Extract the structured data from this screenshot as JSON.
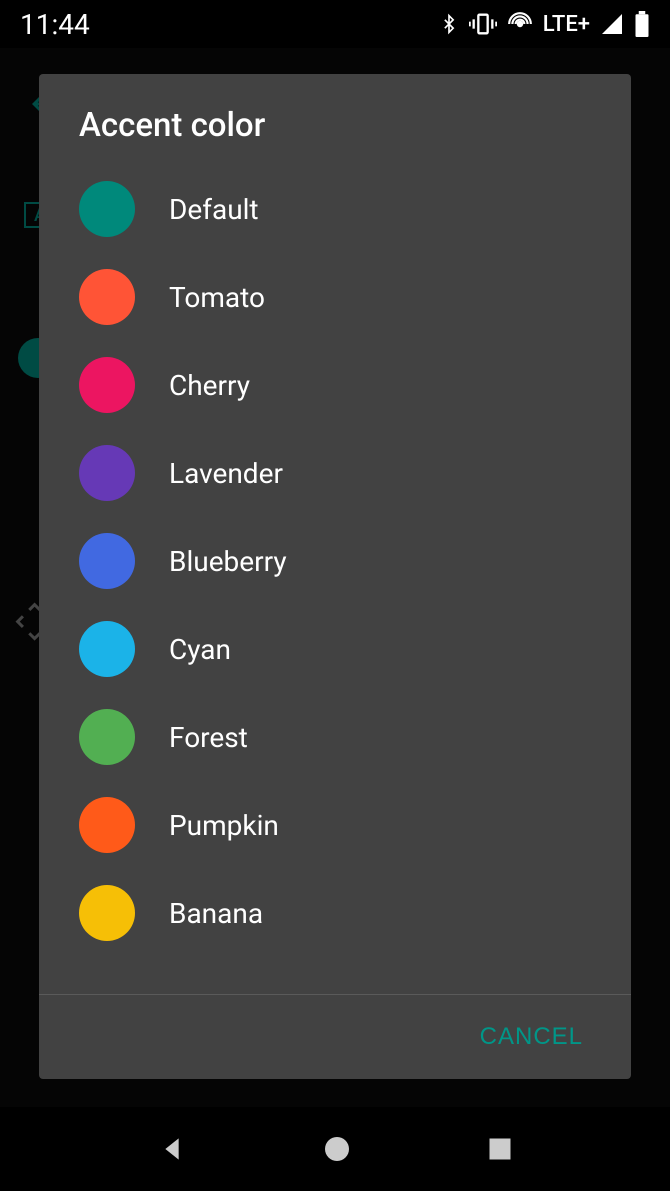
{
  "status": {
    "time": "11:44",
    "network": "LTE+"
  },
  "dialog": {
    "title": "Accent color",
    "cancel": "CANCEL",
    "colors": [
      {
        "name": "Default",
        "hex": "#008577"
      },
      {
        "name": "Tomato",
        "hex": "#F4511E"
      },
      {
        "name": "Cherry",
        "hex": "#E91E63"
      },
      {
        "name": "Lavender",
        "hex": "#673AB7"
      },
      {
        "name": "Blueberry",
        "hex": "#3B78E7"
      },
      {
        "name": "Cyan",
        "hex": "#00B8D4"
      },
      {
        "name": "Forest",
        "hex": "#4CAF50"
      },
      {
        "name": "Pumpkin",
        "hex": "#F4511E"
      },
      {
        "name": "Banana",
        "hex": "#F9C000"
      }
    ]
  },
  "colors_actual": {
    "0": "#00897B",
    "1": "#FF5436",
    "2": "#EC1561",
    "3": "#6639B6",
    "4": "#4169E1",
    "5": "#1BB3E8",
    "6": "#52AF52",
    "7": "#FF5A19",
    "8": "#F6BF06"
  }
}
